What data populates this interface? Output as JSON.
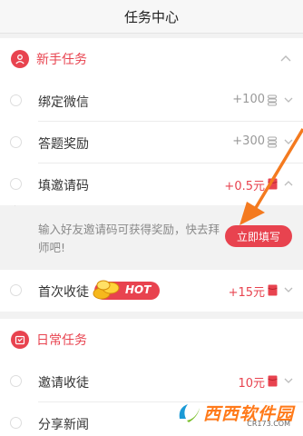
{
  "header": {
    "title": "任务中心"
  },
  "sections": [
    {
      "title": "新手任务"
    },
    {
      "title": "日常任务"
    }
  ],
  "newbie_tasks": [
    {
      "label": "绑定微信",
      "reward": "+100",
      "reward_icon": "coin-stack-icon"
    },
    {
      "label": "答题奖励",
      "reward": "+300",
      "reward_icon": "coin-stack-icon"
    },
    {
      "label": "填邀请码",
      "reward": "+0.5元",
      "reward_icon": "red-envelope-icon"
    },
    {
      "label": "首次收徒",
      "reward": "+15元",
      "reward_icon": "red-envelope-icon",
      "badge": "HOT"
    }
  ],
  "invite_panel": {
    "description": "输入好友邀请码可获得奖励，快去拜师吧!",
    "button_label": "立即填写"
  },
  "daily_tasks": [
    {
      "label": "邀请收徒",
      "reward": "10元",
      "reward_icon": "red-envelope-icon"
    },
    {
      "label": "分享新闻",
      "reward": "",
      "reward_icon": "coin-stack-icon"
    }
  ],
  "watermark": {
    "text": "西西软件园",
    "sub": "CR173.COM"
  },
  "colors": {
    "accent": "#e8434f",
    "arrow": "#f47a1f"
  }
}
